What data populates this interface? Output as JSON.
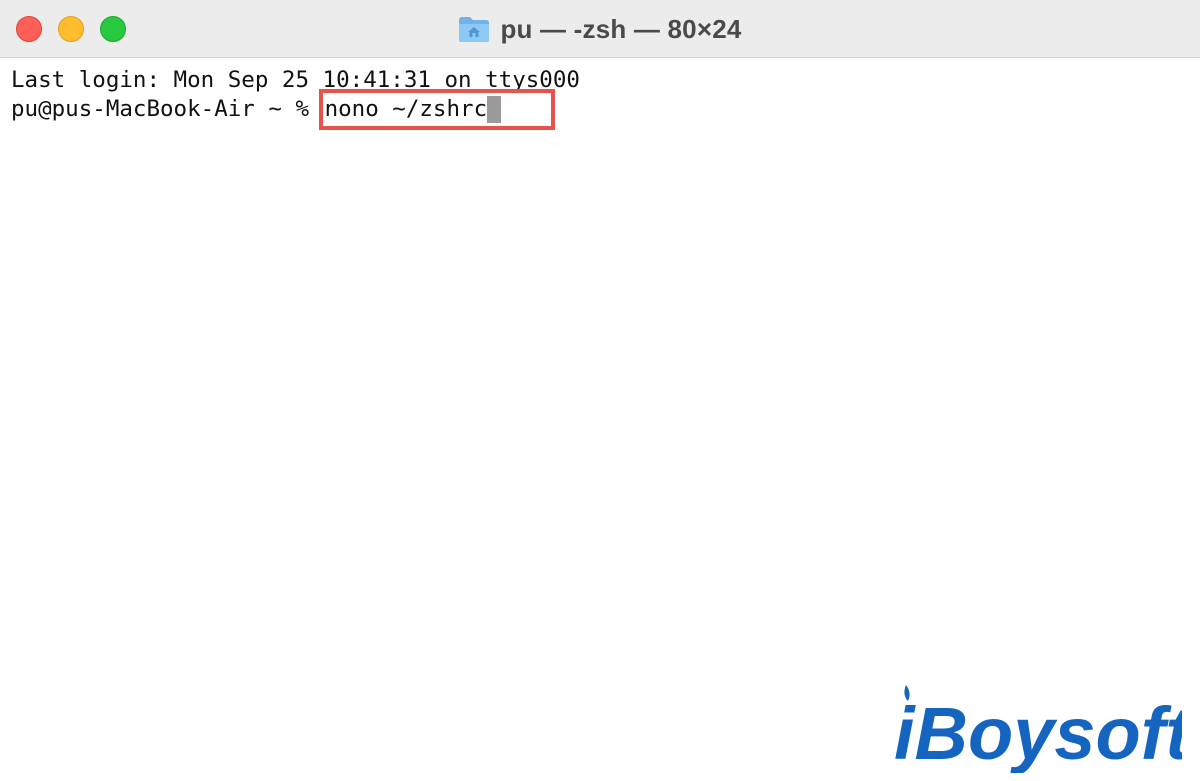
{
  "window": {
    "title": "pu — -zsh — 80×24",
    "title_icon": "home-folder-icon",
    "colors": {
      "close": "#ff5f57",
      "minimize": "#febc2e",
      "zoom": "#28c840",
      "highlight": "#e5534b",
      "watermark": "#1565c0"
    }
  },
  "terminal": {
    "last_login": "Last login: Mon Sep 25 10:41:31 on ttys000",
    "prompt": "pu@pus-MacBook-Air ~ % ",
    "command": "nono ~/zshrc"
  },
  "watermark": {
    "text": "iBoysoft"
  }
}
